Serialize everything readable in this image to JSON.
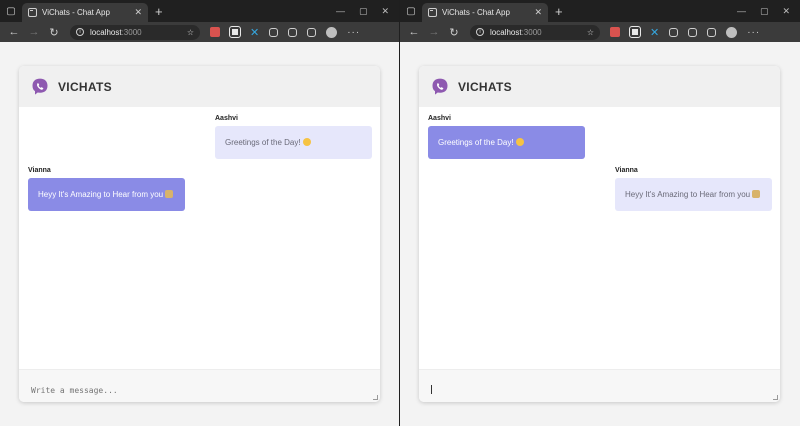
{
  "windows": [
    {
      "tab": {
        "title": "ViChats - Chat App"
      },
      "address": {
        "host": "localhost",
        "port": ":3000"
      },
      "app": {
        "name": "VICHATS"
      },
      "messages": [
        {
          "sender": "Aashvi",
          "text": "Greetings of the Day!",
          "side": "right",
          "style": "own"
        },
        {
          "sender": "Vianna",
          "text": "Heyy It's Amazing to Hear from you",
          "side": "left",
          "style": "other"
        }
      ],
      "composer": {
        "placeholder": "Write a message...",
        "focused": false
      }
    },
    {
      "tab": {
        "title": "ViChats - Chat App"
      },
      "address": {
        "host": "localhost",
        "port": ":3000"
      },
      "app": {
        "name": "VICHATS"
      },
      "messages": [
        {
          "sender": "Aashvi",
          "text": "Greetings of the Day!",
          "side": "left",
          "style": "other"
        },
        {
          "sender": "Vianna",
          "text": "Heyy It's Amazing to Hear from you",
          "side": "right",
          "style": "own"
        }
      ],
      "composer": {
        "placeholder": "Write a message...",
        "focused": true
      }
    }
  ],
  "colors": {
    "accent": "#8a8be6",
    "own_bubble": "#e6e7fb",
    "logo": "#8e59b0"
  },
  "icons": {
    "tab_actions": "tab-actions-icon",
    "favicon": "page-icon",
    "close": "close-icon",
    "new_tab": "plus-icon",
    "back": "arrow-left-icon",
    "forward": "arrow-right-icon",
    "refresh": "refresh-icon",
    "info": "info-icon",
    "logo": "viber-logo-icon"
  }
}
